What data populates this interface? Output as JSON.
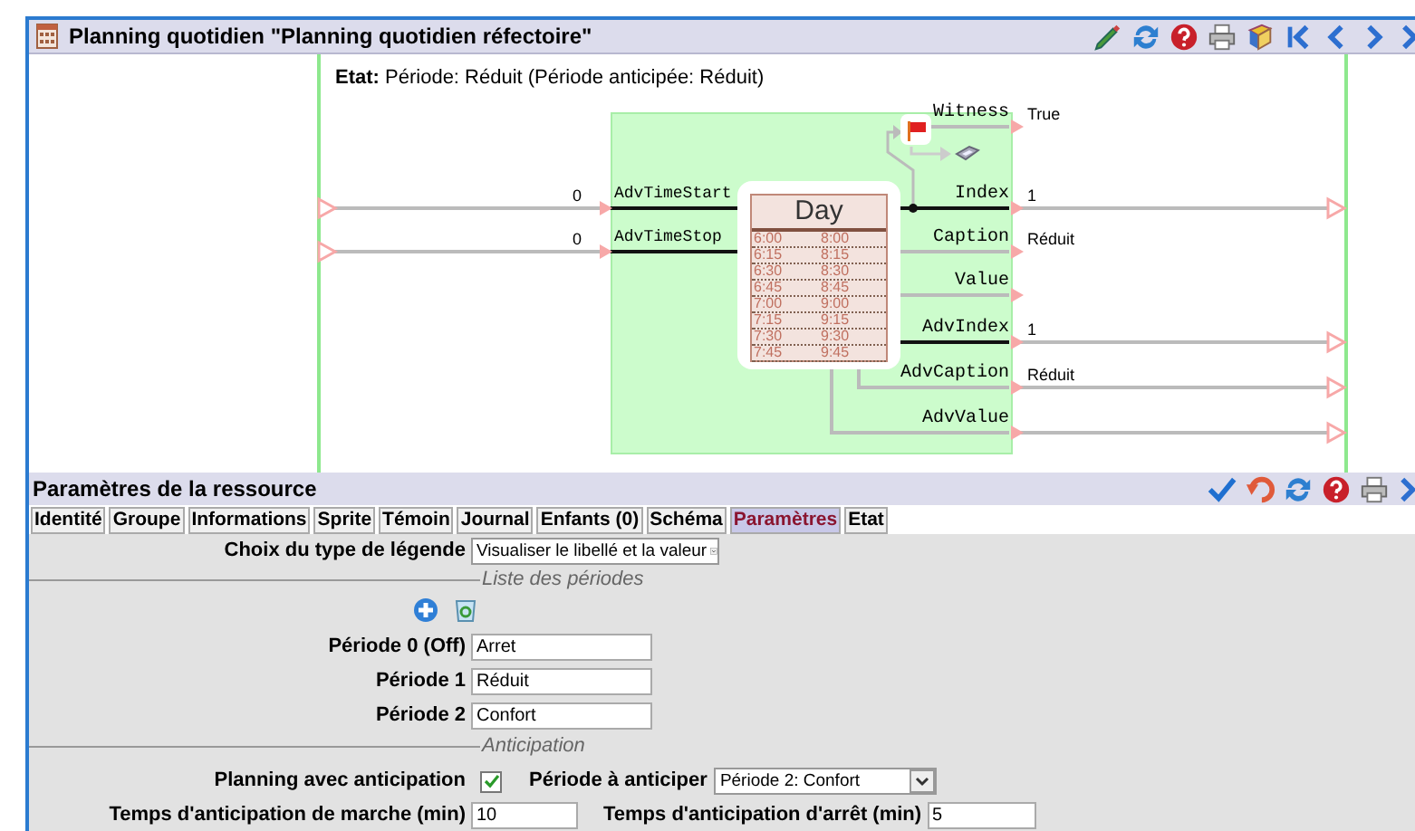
{
  "window": {
    "title": "Planning quotidien \"Planning quotidien réfectoire\""
  },
  "state": {
    "label": "Etat:",
    "text": "Période: Réduit (Période anticipée: Réduit)"
  },
  "diagram": {
    "inputs": [
      {
        "label": "AdvTimeStart",
        "value": "0"
      },
      {
        "label": "AdvTimeStop",
        "value": "0"
      }
    ],
    "widget": {
      "title": "Day",
      "rows": [
        [
          "6:00",
          "8:00"
        ],
        [
          "6:15",
          "8:15"
        ],
        [
          "6:30",
          "8:30"
        ],
        [
          "6:45",
          "8:45"
        ],
        [
          "7:00",
          "9:00"
        ],
        [
          "7:15",
          "9:15"
        ],
        [
          "7:30",
          "9:30"
        ],
        [
          "7:45",
          "9:45"
        ]
      ]
    },
    "outputs": [
      {
        "label": "Witness",
        "value": "True",
        "kind": "witness",
        "active": false,
        "linked": false
      },
      {
        "label": "Index",
        "value": "1",
        "kind": "side",
        "active": true,
        "linked": true
      },
      {
        "label": "Caption",
        "value": "Réduit",
        "kind": "side",
        "active": false,
        "linked": false
      },
      {
        "label": "Value",
        "kind": "side",
        "active": false,
        "linked": false
      },
      {
        "label": "AdvIndex",
        "value": "1",
        "kind": "side",
        "active": true,
        "linked": true
      },
      {
        "label": "AdvCaption",
        "value": "Réduit",
        "kind": "below",
        "active": false,
        "linked": true
      },
      {
        "label": "AdvValue",
        "kind": "below",
        "active": false,
        "linked": true
      }
    ]
  },
  "parameters": {
    "title": "Paramètres de la ressource",
    "tabs": [
      {
        "label": "Identité",
        "selected": false
      },
      {
        "label": "Groupe",
        "selected": false
      },
      {
        "label": "Informations",
        "selected": false
      },
      {
        "label": "Sprite",
        "selected": false
      },
      {
        "label": "Témoin",
        "selected": false
      },
      {
        "label": "Journal",
        "selected": false
      },
      {
        "label": "Enfants (0)",
        "selected": false
      },
      {
        "label": "Schéma",
        "selected": false
      },
      {
        "label": "Paramètres",
        "selected": true
      },
      {
        "label": "Etat",
        "selected": false
      }
    ],
    "legend_type": {
      "label": "Choix du type de légende",
      "value": "Visualiser le libellé et la valeur"
    },
    "periods_section": "Liste des périodes",
    "periods": [
      {
        "label": "Période 0 (Off)",
        "value": "Arret"
      },
      {
        "label": "Période 1",
        "value": "Réduit"
      },
      {
        "label": "Période 2",
        "value": "Confort"
      }
    ],
    "anticipation_section": "Anticipation",
    "anticipation": {
      "label": "Planning avec anticipation",
      "checked": true
    },
    "period_to_anticipate": {
      "label": "Période à anticiper",
      "value": "Période 2:  Confort"
    },
    "start_time": {
      "label": "Temps d'anticipation de marche (min)",
      "value": "10"
    },
    "stop_time": {
      "label": "Temps d'anticipation d'arrêt (min)",
      "value": "5"
    }
  }
}
